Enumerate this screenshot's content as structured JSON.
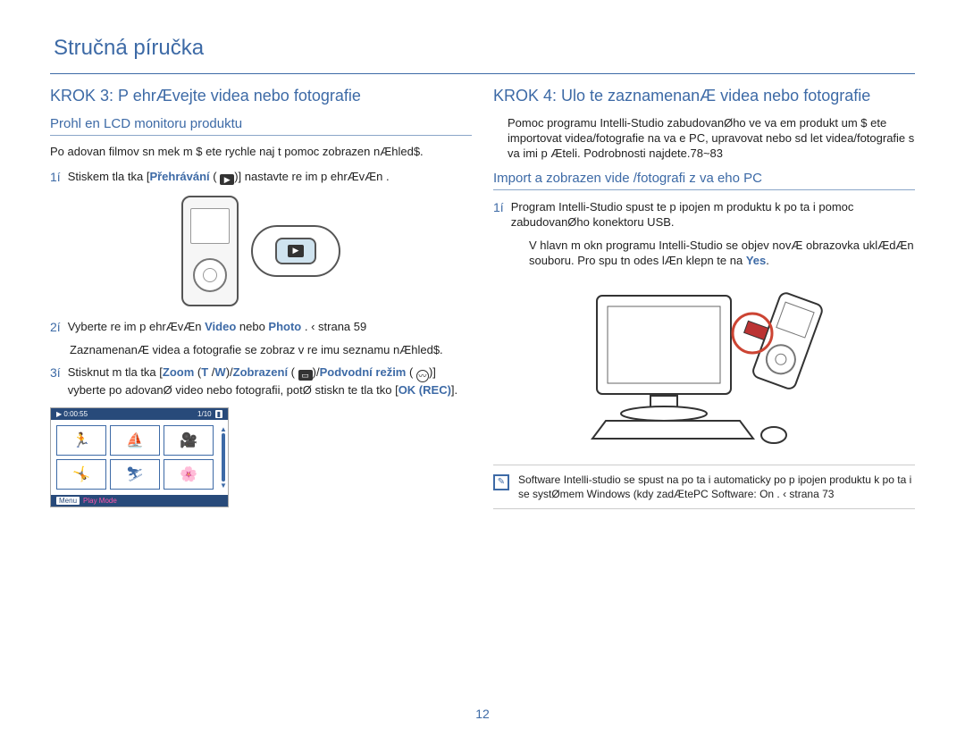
{
  "page_title": "Stručná píručka",
  "page_number": "12",
  "left": {
    "step_title": "KROK 3: P ehrÆvejte videa nebo fotografie",
    "sub_title": "Prohl en  LCD monitoru produktu",
    "intro": "Po adovan  filmov  sn mek m $ ete rychle naj t pomoc  zobrazen  nÆhled$.",
    "items": {
      "n1": "1í",
      "t1_a": "Stiskem tla  tka [",
      "t1_b": "Přehrávání",
      "t1_c": " ( ",
      "t1_d": ")] nastavte re im p ehrÆvÆn .",
      "n2": "2í",
      "t2_a": "Vyberte re im p ehrÆvÆn ",
      "t2_b": "Video",
      "t2_mid": " nebo ",
      "t2_c": "Photo",
      "t2_end": " . ‹ strana 59",
      "t2_sub": "ZaznamenanÆ videa a fotografie se zobraz  v re imu seznamu nÆhled$.",
      "n3": "3í",
      "t3_a": "Stisknut m tla  tka [",
      "t3_b": "Zoom",
      "t3_c": " (",
      "t3_d": "T ",
      "t3_e": "/",
      "t3_f": "W",
      "t3_g": ")/",
      "t3_h": "Zobrazení",
      "t3_i": " ( ",
      "t3_j": ")/",
      "t3_k": "Podvodní režim",
      "t3_l": " ( ",
      "t3_m": ")] vyberte po adovanØ video nebo fotografii, potØ stiskn  te tla  tko [",
      "t3_n": "OK (REC)",
      "t3_o": "]."
    },
    "thumb": {
      "time": "0:00:55",
      "count": "1/10",
      "mode": "Play Mode",
      "menu": "Menu"
    }
  },
  "right": {
    "step_title": "KROK 4: Ulo te zaznamenanÆ videa nebo fotografie",
    "intro": "Pomoc  programu Intelli-Studio zabudovanØho ve va em produkt um $ ete importovat videa/fotografie na va e PC, upravovat nebo sd let videa/fotografie s va imi p Æteli. Podrobnosti najdete.78~83",
    "sub_title": "Import a zobrazen  vide /fotografi  z va eho PC",
    "items": {
      "n1": "1í",
      "t1_a": "Program Intelli-Studio spust te p ipojen m produktu k po  ta i pomoc  zabudovanØho konektoru USB.",
      "t1_sub_a": "V hlavn m okn  programu Intelli-Studio se objev  novÆ obrazovka uklÆdÆn  souboru. Pro spu tn  odes lÆn  klepn  te na ",
      "t1_sub_b": "Yes",
      "t1_sub_c": "."
    },
    "note": "Software Intelli-studio se spust  na po  ta i automaticky po p ipojen  produktu k po  ta i se systØmem Windows (kdy  zadÆtePC Software: On . ‹ strana 73",
    "note_bold": "PC Software: On"
  }
}
